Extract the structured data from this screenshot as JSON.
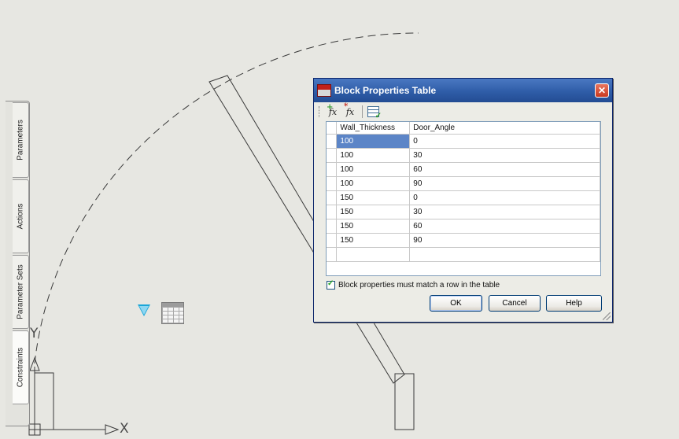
{
  "palette": {
    "tabs": [
      {
        "label": "Parameters"
      },
      {
        "label": "Actions"
      },
      {
        "label": "Parameter Sets"
      },
      {
        "label": "Constraints"
      }
    ]
  },
  "axis": {
    "y": "Y",
    "x": "X"
  },
  "dialog": {
    "title": "Block Properties Table",
    "close_label": "✕",
    "toolbar": {
      "add_icon": "add-property-icon",
      "modify_icon": "modify-property-icon",
      "audit_icon": "audit-table-icon"
    },
    "table": {
      "columns": [
        "Wall_Thickness",
        "Door_Angle"
      ],
      "rows": [
        [
          "100",
          "0"
        ],
        [
          "100",
          "30"
        ],
        [
          "100",
          "60"
        ],
        [
          "100",
          "90"
        ],
        [
          "150",
          "0"
        ],
        [
          "150",
          "30"
        ],
        [
          "150",
          "60"
        ],
        [
          "150",
          "90"
        ],
        [
          "",
          ""
        ]
      ]
    },
    "checkbox_label": "Block properties must match a row in the table",
    "checkbox_checked": true,
    "buttons": {
      "ok": "OK",
      "cancel": "Cancel",
      "help": "Help"
    }
  },
  "colors": {
    "selected_cell": "#5c85c7",
    "titlebar": "#2f5da8",
    "param_marker": "#1aa6d8"
  }
}
